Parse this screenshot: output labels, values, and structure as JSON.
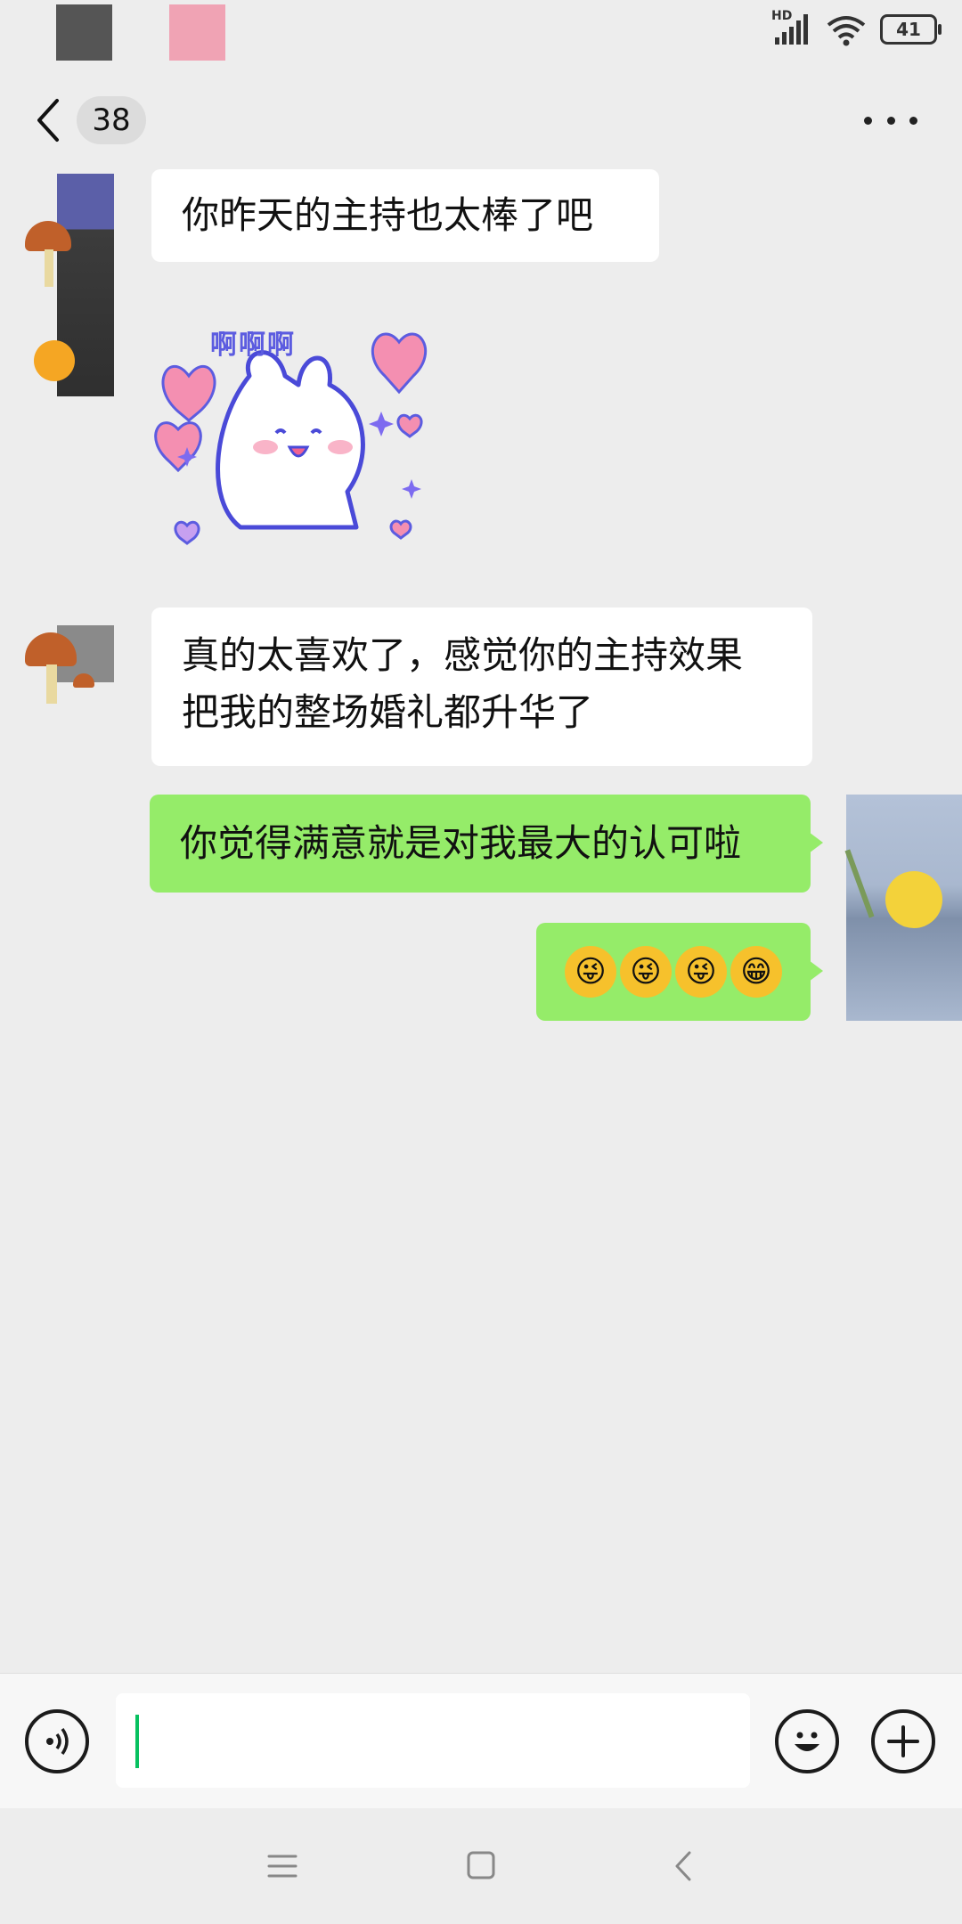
{
  "status_bar": {
    "network_label": "HD",
    "battery_level": "41"
  },
  "header": {
    "unread_count": "38"
  },
  "messages": [
    {
      "direction": "incoming",
      "type": "text",
      "text": "你昨天的主持也太棒了吧"
    },
    {
      "direction": "incoming",
      "type": "sticker",
      "sticker_text": "啊啊啊"
    },
    {
      "direction": "incoming",
      "type": "text",
      "lines": [
        "真的太喜欢了，感觉你的主持效果",
        "把我的整场婚礼都升华了"
      ]
    },
    {
      "direction": "outgoing",
      "type": "text",
      "text": "你觉得满意就是对我最大的认可啦"
    },
    {
      "direction": "outgoing",
      "type": "emoji",
      "emoji": [
        "😜",
        "😜",
        "😜",
        "😁"
      ]
    }
  ],
  "input_bar": {
    "value": ""
  },
  "colors": {
    "background": "#ededed",
    "incoming_bubble": "#ffffff",
    "outgoing_bubble": "#95ec69",
    "cursor": "#07c160"
  }
}
